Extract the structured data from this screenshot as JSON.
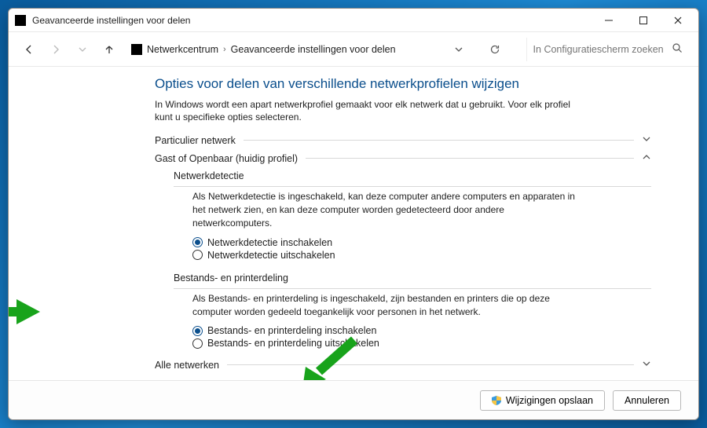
{
  "window": {
    "title": "Geavanceerde instellingen voor delen"
  },
  "breadcrumb": {
    "root": "Netwerkcentrum",
    "current": "Geavanceerde instellingen voor delen"
  },
  "search": {
    "placeholder": "In Configuratiescherm zoeken"
  },
  "main": {
    "heading": "Opties voor delen van verschillende netwerkprofielen wijzigen",
    "intro": "In Windows wordt een apart netwerkprofiel gemaakt voor elk netwerk dat u gebruikt. Voor elk profiel kunt u specifieke opties selecteren.",
    "section_private": "Particulier netwerk",
    "section_guest": "Gast of Openbaar (huidig profiel)",
    "net_detect_title": "Netwerkdetectie",
    "net_detect_desc": "Als Netwerkdetectie is ingeschakeld, kan deze computer andere computers en apparaten in het netwerk zien, en kan deze computer worden gedetecteerd door andere netwerkcomputers.",
    "net_detect_on": "Netwerkdetectie inschakelen",
    "net_detect_off": "Netwerkdetectie uitschakelen",
    "file_share_title": "Bestands- en printerdeling",
    "file_share_desc": "Als Bestands- en printerdeling is ingeschakeld, zijn bestanden en printers die op deze computer worden gedeeld toegankelijk voor personen in het netwerk.",
    "file_share_on": "Bestands- en printerdeling inschakelen",
    "file_share_off": "Bestands- en printerdeling uitschakelen",
    "section_all": "Alle netwerken"
  },
  "footer": {
    "save": "Wijzigingen opslaan",
    "cancel": "Annuleren"
  }
}
